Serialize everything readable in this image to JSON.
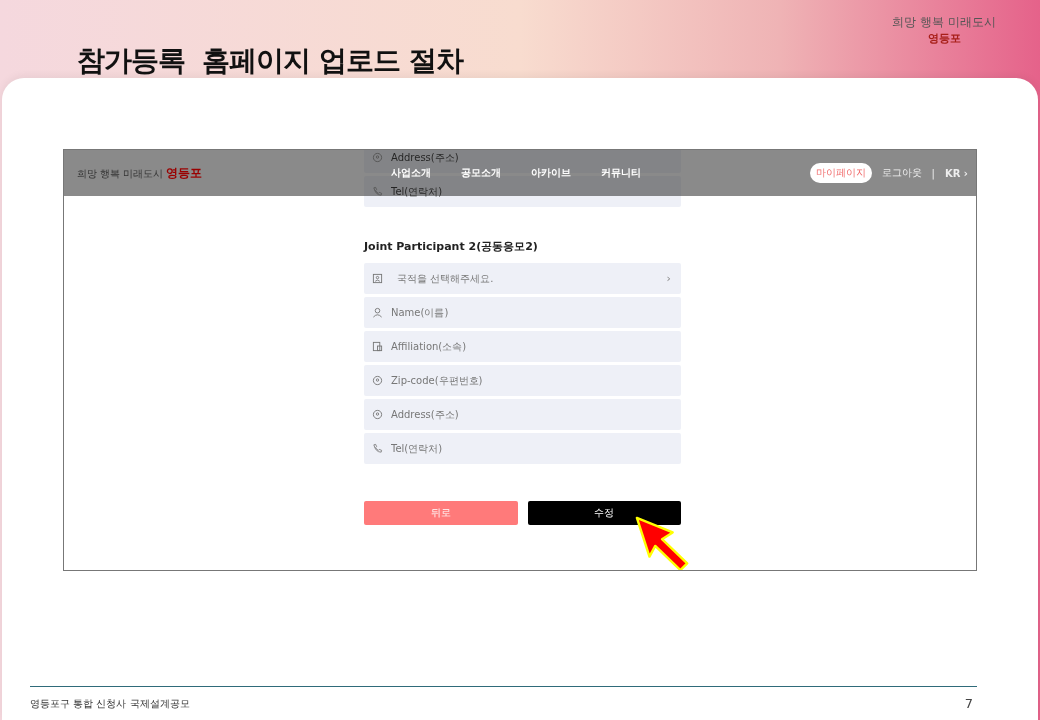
{
  "slide": {
    "title": "참가등록  홈페이지 업로드 절차",
    "logo": {
      "text": "희망 행복 미래도시",
      "accent": "영등포"
    }
  },
  "site_header": {
    "logo": {
      "text": "희망 행복 미래도시",
      "accent": "영등포"
    },
    "nav": [
      "사업소개",
      "공모소개",
      "아카이브",
      "커뮤니티"
    ],
    "mypage": "마이페이지",
    "logout": "로그아웃",
    "separator": "|",
    "language": "KR",
    "language_caret": "›"
  },
  "form": {
    "previous_fields": [
      {
        "kind": "address",
        "placeholder": "Address(주소)"
      },
      {
        "kind": "phone",
        "placeholder": "Tel(연락처)"
      }
    ],
    "section_title": "Joint Participant 2(공동응모2)",
    "fields": [
      {
        "kind": "select",
        "prompt": "국적을 선택해주세요.",
        "caret": "›"
      },
      {
        "kind": "name",
        "placeholder": "Name(이름)"
      },
      {
        "kind": "affiliation",
        "placeholder": "Affiliation(소속)"
      },
      {
        "kind": "address",
        "placeholder": "Zip-code(우편번호)"
      },
      {
        "kind": "address",
        "placeholder": "Address(주소)"
      },
      {
        "kind": "phone",
        "placeholder": "Tel(연락처)"
      }
    ],
    "buttons": [
      {
        "kind": "secondary",
        "label": "뒤로"
      },
      {
        "kind": "primary",
        "label": "수정"
      }
    ]
  },
  "footer": {
    "text": "영등포구 통합 신청사 국제설계공모",
    "page": "7"
  }
}
